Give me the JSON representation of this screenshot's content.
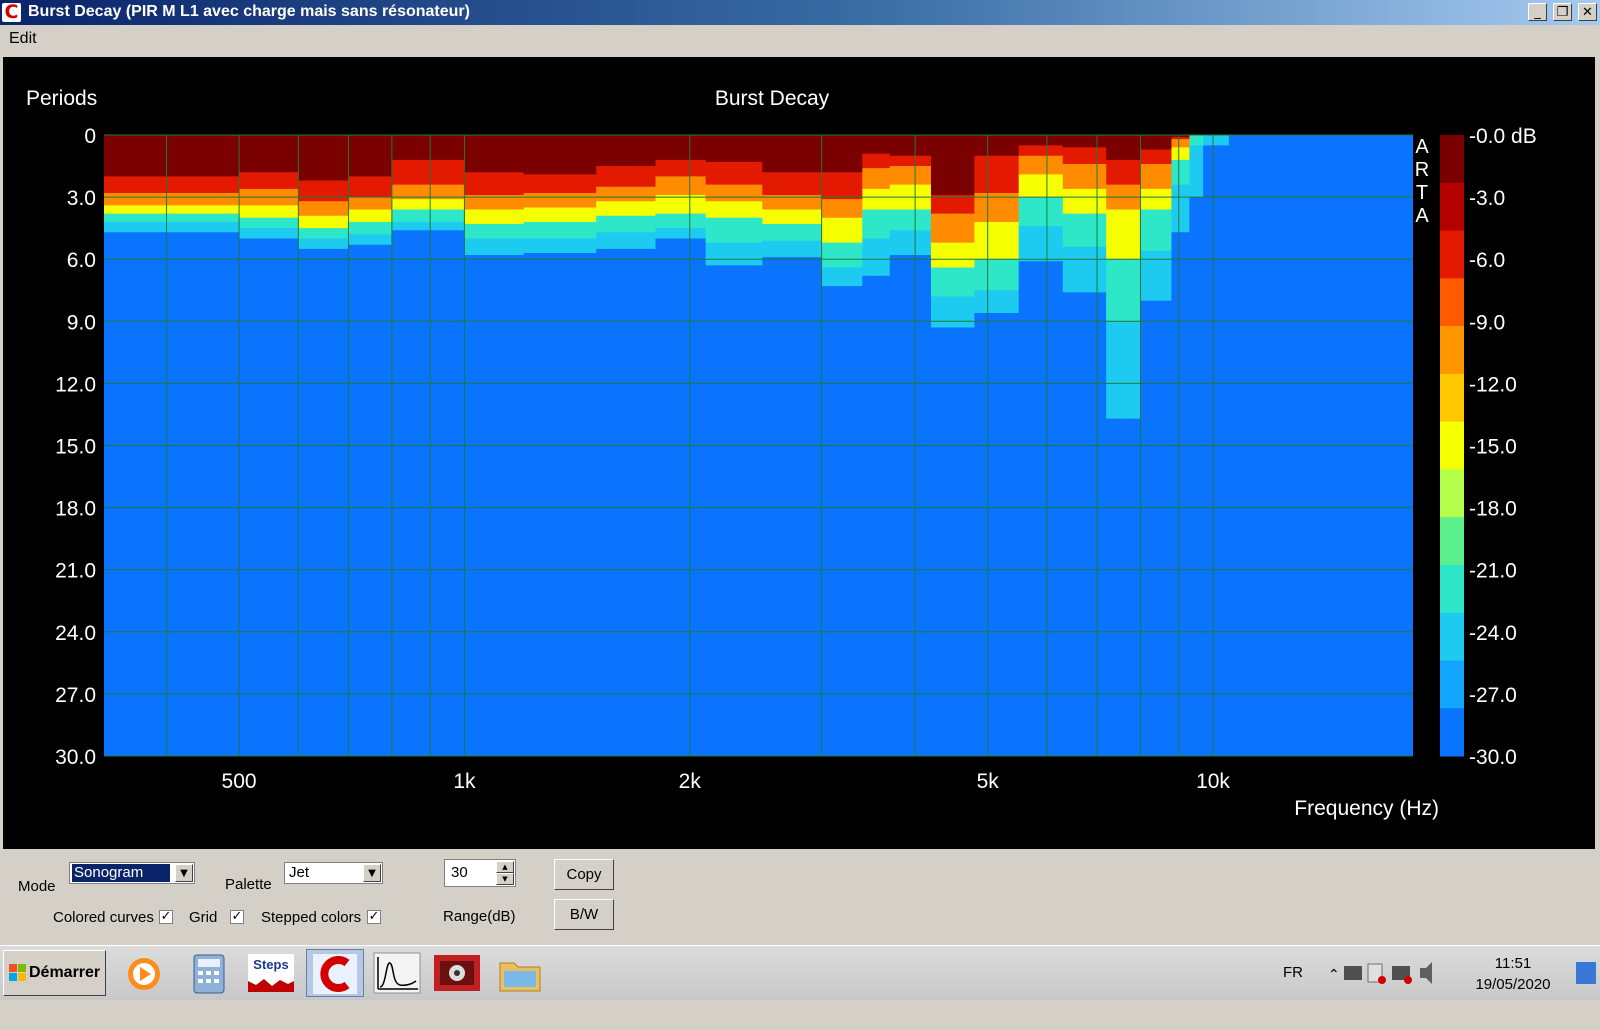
{
  "window": {
    "title": "Burst Decay  (PIR M L1 avec charge mais sans résonateur)",
    "buttons": [
      "_",
      "❐",
      "✕"
    ]
  },
  "menu": {
    "edit": "Edit"
  },
  "chart_data": {
    "type": "heatmap",
    "title": "Burst Decay",
    "ylabel": "Periods",
    "xlabel": "Frequency (Hz)",
    "x_scale": "log",
    "xlim": [
      330,
      18500
    ],
    "ylim": [
      0,
      30
    ],
    "x_ticks": [
      {
        "value": 500,
        "label": "500"
      },
      {
        "value": 1000,
        "label": "1k"
      },
      {
        "value": 2000,
        "label": "2k"
      },
      {
        "value": 5000,
        "label": "5k"
      },
      {
        "value": 10000,
        "label": "10k"
      }
    ],
    "x_grid": [
      400,
      500,
      600,
      700,
      800,
      900,
      1000,
      2000,
      3000,
      4000,
      5000,
      6000,
      7000,
      8000,
      9000,
      10000
    ],
    "y_ticks": [
      "0",
      "3.0",
      "6.0",
      "9.0",
      "12.0",
      "15.0",
      "18.0",
      "21.0",
      "24.0",
      "27.0",
      "30.0"
    ],
    "grid": true,
    "watermark": "ARTA",
    "colorbar": {
      "unit": "dB",
      "labels": [
        "-0.0 dB",
        "-3.0",
        "-6.0",
        "-9.0",
        "-12.0",
        "-15.0",
        "-18.0",
        "-21.0",
        "-24.0",
        "-27.0",
        "-30.0"
      ],
      "steps": [
        "#7b0000",
        "#b50000",
        "#e31a00",
        "#ff5a00",
        "#ff9600",
        "#ffc800",
        "#f5ff00",
        "#b4ff4a",
        "#5cf08c",
        "#2ee6c8",
        "#1ecbf0",
        "#12a5ff",
        "#0a74ff"
      ]
    },
    "background_color": "#0a74ff",
    "decay_profile": [
      {
        "f": 330,
        "d": [
          2.0,
          2.8,
          3.4,
          3.8,
          4.2,
          4.7
        ]
      },
      {
        "f": 500,
        "d": [
          1.8,
          2.6,
          3.4,
          4.0,
          4.5,
          5.0
        ]
      },
      {
        "f": 600,
        "d": [
          2.2,
          3.2,
          3.9,
          4.5,
          5.0,
          5.5
        ]
      },
      {
        "f": 700,
        "d": [
          2.0,
          3.0,
          3.6,
          4.2,
          4.8,
          5.3
        ]
      },
      {
        "f": 800,
        "d": [
          1.2,
          2.4,
          3.1,
          3.6,
          4.2,
          4.6
        ]
      },
      {
        "f": 1000,
        "d": [
          1.8,
          2.9,
          3.6,
          4.3,
          5.0,
          5.8
        ]
      },
      {
        "f": 1200,
        "d": [
          1.9,
          2.8,
          3.5,
          4.2,
          5.0,
          5.7
        ]
      },
      {
        "f": 1500,
        "d": [
          1.5,
          2.5,
          3.2,
          3.9,
          4.7,
          5.5
        ]
      },
      {
        "f": 1800,
        "d": [
          1.2,
          2.0,
          2.9,
          3.8,
          4.5,
          5.0
        ]
      },
      {
        "f": 2100,
        "d": [
          1.3,
          2.4,
          3.2,
          4.0,
          5.2,
          6.3
        ]
      },
      {
        "f": 2500,
        "d": [
          1.8,
          2.9,
          3.6,
          4.3,
          5.1,
          5.9
        ]
      },
      {
        "f": 3000,
        "d": [
          1.8,
          3.1,
          4.0,
          5.2,
          6.4,
          7.3
        ]
      },
      {
        "f": 3400,
        "d": [
          0.9,
          1.6,
          2.6,
          3.6,
          5.0,
          6.8
        ]
      },
      {
        "f": 3700,
        "d": [
          1.0,
          1.5,
          2.4,
          3.6,
          4.6,
          5.8
        ]
      },
      {
        "f": 4200,
        "d": [
          2.9,
          3.8,
          5.2,
          6.4,
          7.8,
          9.3
        ]
      },
      {
        "f": 4800,
        "d": [
          1.0,
          2.8,
          4.2,
          6.0,
          7.5,
          8.6
        ]
      },
      {
        "f": 5500,
        "d": [
          0.5,
          1.0,
          1.9,
          3.0,
          4.4,
          6.1
        ]
      },
      {
        "f": 6300,
        "d": [
          0.6,
          1.4,
          2.6,
          3.8,
          5.4,
          7.6
        ]
      },
      {
        "f": 7200,
        "d": [
          1.2,
          2.4,
          3.6,
          6.0,
          9.0,
          13.7
        ]
      },
      {
        "f": 8000,
        "d": [
          0.7,
          1.4,
          2.6,
          3.6,
          5.6,
          8.0
        ]
      },
      {
        "f": 8800,
        "d": [
          0.1,
          0.2,
          0.6,
          1.2,
          2.4,
          4.7
        ]
      },
      {
        "f": 9300,
        "d": [
          0.0,
          0.0,
          0.0,
          0.0,
          0.5,
          3.0
        ]
      },
      {
        "f": 9700,
        "d": [
          0.0,
          0.0,
          0.0,
          0.0,
          0.0,
          0.5
        ]
      },
      {
        "f": 10500,
        "d": [
          0.0,
          0.0,
          0.0,
          0.0,
          0.0,
          0.0
        ]
      },
      {
        "f": 18500,
        "d": [
          0.0,
          0.0,
          0.0,
          0.0,
          0.0,
          0.0
        ]
      }
    ]
  },
  "controls": {
    "mode_label": "Mode",
    "mode_value": "Sonogram",
    "palette_label": "Palette",
    "palette_value": "Jet",
    "range_value": "30",
    "range_label": "Range(dB)",
    "copy_label": "Copy",
    "bw_label": "B/W",
    "colored_curves_label": "Colored curves",
    "colored_curves_checked": true,
    "grid_label": "Grid",
    "grid_checked": true,
    "stepped_colors_label": "Stepped colors",
    "stepped_colors_checked": true
  },
  "taskbar": {
    "start_label": "Démarrer",
    "apps": [
      "media-player-icon",
      "calculator-icon",
      "steps-icon",
      "arta-icon",
      "limp-icon",
      "vituixcad-icon",
      "explorer-icon"
    ],
    "steps_label": "Steps",
    "lang": "FR",
    "time": "11:51",
    "date": "19/05/2020"
  }
}
